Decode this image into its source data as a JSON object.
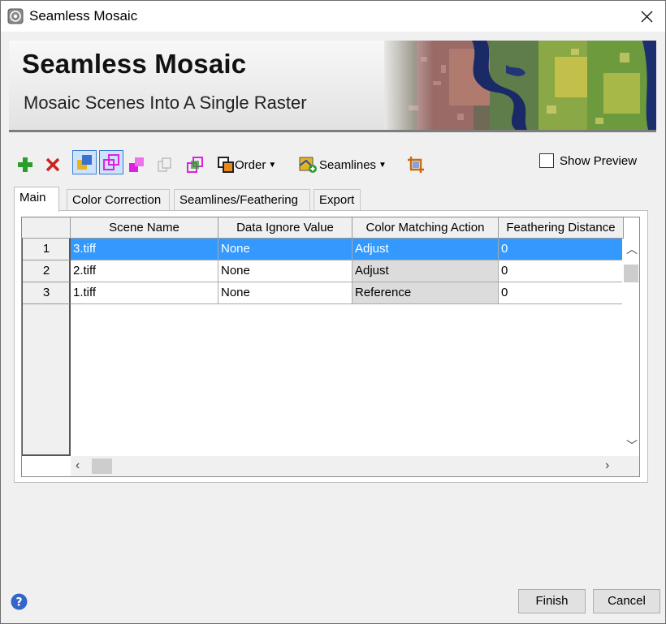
{
  "window": {
    "title": "Seamless Mosaic"
  },
  "banner": {
    "title": "Seamless Mosaic",
    "subtitle": "Mosaic Scenes Into A Single Raster"
  },
  "toolbar": {
    "order_label": "Order",
    "seamlines_label": "Seamlines",
    "show_preview_label": "Show Preview",
    "show_preview_checked": false
  },
  "tabs": [
    {
      "label": "Main",
      "active": true
    },
    {
      "label": "Color Correction",
      "active": false
    },
    {
      "label": "Seamlines/Feathering",
      "active": false
    },
    {
      "label": "Export",
      "active": false
    }
  ],
  "table": {
    "columns": [
      "Scene Name",
      "Data Ignore Value",
      "Color Matching Action",
      "Feathering Distance"
    ],
    "rows": [
      {
        "num": "1",
        "cells": [
          "3.tiff",
          "None",
          "Adjust",
          "0"
        ],
        "selected": true
      },
      {
        "num": "2",
        "cells": [
          "2.tiff",
          "None",
          "Adjust",
          "0"
        ],
        "selected": false
      },
      {
        "num": "3",
        "cells": [
          "1.tiff",
          "None",
          "Reference",
          "0"
        ],
        "selected": false
      }
    ]
  },
  "buttons": {
    "finish": "Finish",
    "cancel": "Cancel"
  },
  "colors": {
    "selection": "#3399ff",
    "add": "#2a9d2a",
    "remove": "#cc2222",
    "magenta": "#e020e0"
  }
}
